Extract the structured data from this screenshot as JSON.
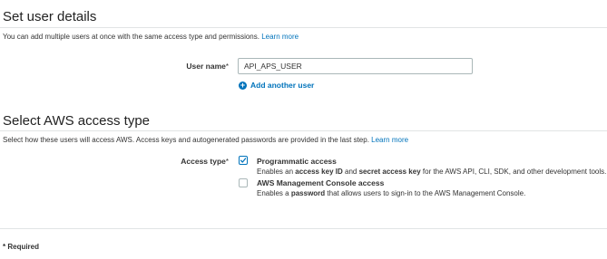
{
  "user_details": {
    "title": "Set user details",
    "description": "You can add multiple users at once with the same access type and permissions.",
    "learn_more": "Learn more",
    "user_name_label": "User name",
    "required_star": "*",
    "user_name_value": "API_APS_USER",
    "add_another_user": "Add another user"
  },
  "access_type": {
    "title": "Select AWS access type",
    "description": "Select how these users will access AWS. Access keys and autogenerated passwords are provided in the last step.",
    "learn_more": "Learn more",
    "label": "Access type",
    "required_star": "*",
    "options": [
      {
        "title": "Programmatic access",
        "checked": true,
        "desc_prefix": "Enables an",
        "desc_bold_1": "access key ID",
        "desc_mid": "and",
        "desc_bold_2": "secret access key",
        "desc_suffix": "for the AWS API, CLI, SDK, and other development tools."
      },
      {
        "title": "AWS Management Console access",
        "checked": false,
        "desc_prefix": "Enables a",
        "desc_bold_1": "password",
        "desc_suffix": "that allows users to sign-in to the AWS Management Console."
      }
    ]
  },
  "footer": {
    "required_note": "* Required"
  },
  "colors": {
    "link": "#0073bb",
    "rule": "#e1e4e5",
    "input_border": "#aab7b8"
  },
  "icons": {
    "add_user": "plus-circle-icon",
    "checkbox_checked": "check-icon"
  }
}
